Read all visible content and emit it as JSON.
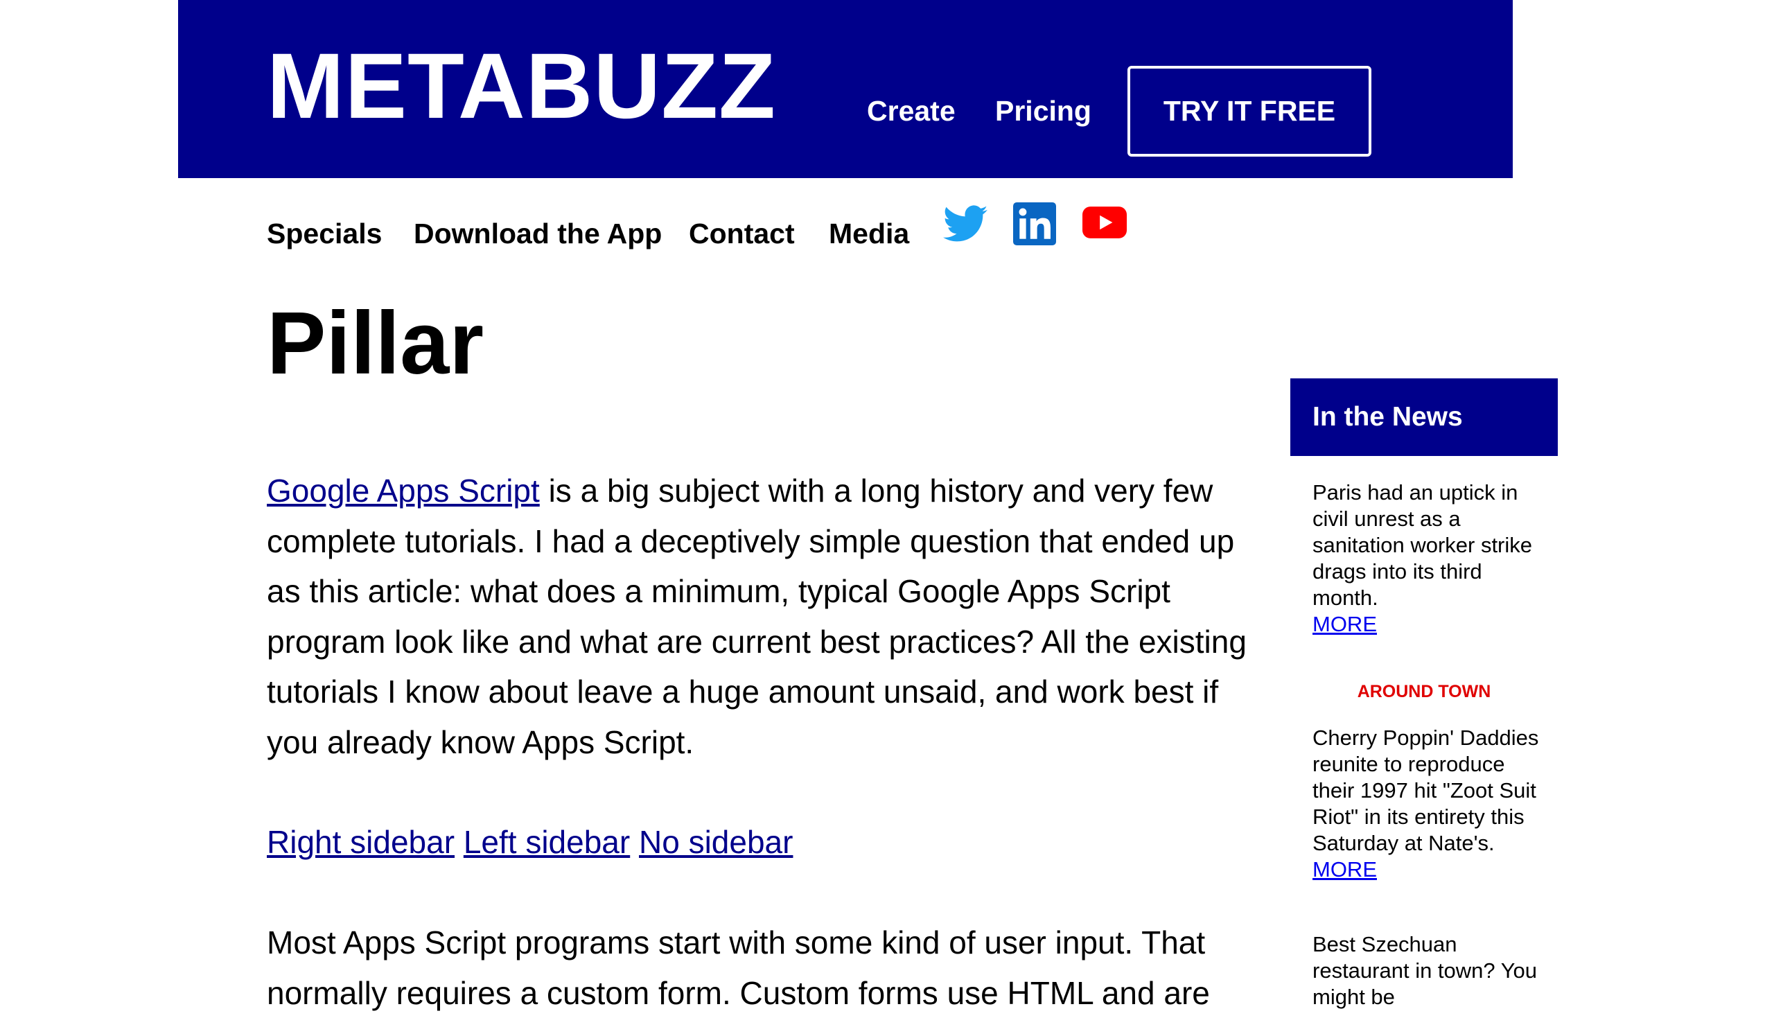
{
  "header": {
    "site_title": "METABUZZ",
    "nav": [
      "Create",
      "Pricing"
    ],
    "cta": "TRY IT FREE",
    "bg_color": "#00008b"
  },
  "subnav": {
    "items": [
      "Specials",
      "Download the App",
      "Contact",
      "Media"
    ],
    "social_icons": [
      "twitter-icon",
      "linkedin-icon",
      "youtube-icon"
    ]
  },
  "page": {
    "title": "Pillar"
  },
  "article": {
    "p1_link": "Google Apps Script",
    "p1_rest": " is a big subject with a long history and very few complete tutorials. I had a deceptively simple question that ended up as this article: what does a minimum, typical Google Apps Script program look like and what are current best practices? All the existing tutorials I know about leave a huge amount unsaid, and work best if you already know Apps Script.",
    "layout_links": [
      "Right sidebar",
      "Left sidebar",
      "No sidebar"
    ],
    "p2": "Most Apps Script programs start with some kind of user input. That normally requires a custom form. Custom forms use HTML and are"
  },
  "sidebar": {
    "header": "In the News",
    "items": [
      {
        "text": "Paris had an uptick in civil unrest as a sanitation worker strike drags into its third month.",
        "more": "MORE"
      },
      {
        "text": "Cherry Poppin' Daddies reunite to reproduce their 1997 hit \"Zoot Suit Riot\" in its entirety this Saturday at Nate's.",
        "more": "MORE"
      },
      {
        "text": "Best Szechuan restaurant in town? You might be",
        "more": ""
      }
    ],
    "section_label": "AROUND TOWN"
  }
}
